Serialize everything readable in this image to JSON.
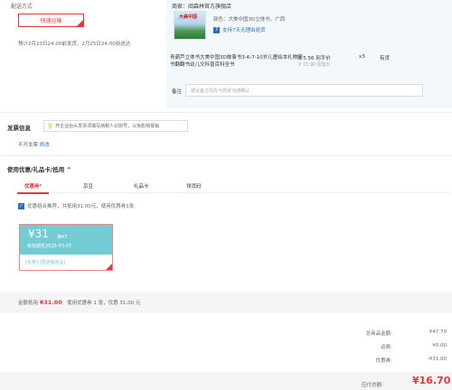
{
  "shipping": {
    "title": "配送方式",
    "option": "快速运输",
    "note": "预计2月23日24:00前发货，2月25日24:00前送达"
  },
  "shop": {
    "label": "商家：",
    "name": "阅森林官方旗舰店"
  },
  "product": {
    "image_text": "大美中国",
    "color": "颜色：大美中国3D立体书，广西",
    "return_policy": "支持7天无理由退货",
    "title": "青葫芦立体书大美中国3D故事书3-6-7-10岁儿童绘本礼物图书翻翻书幼儿文科普百科全书",
    "price": "¥ 5.56 到手价",
    "original_price": "¥ 15.90 原售价",
    "quantity": "x3",
    "stock": "有货"
  },
  "remark": {
    "label": "备注",
    "placeholder": "建议备注前先与商家沟通确认"
  },
  "invoice": {
    "title": "发票信息",
    "notice": "开企业抬头发票须填写纳税人识别号，以免影响报销",
    "status": "不开发票",
    "edit": "修改"
  },
  "coupons": {
    "title": "使用优惠/礼品卡/抵用 ^",
    "tabs": [
      {
        "label": "优惠券⁸"
      },
      {
        "label": "京豆"
      },
      {
        "label": "礼品卡"
      },
      {
        "label": "领货码"
      }
    ],
    "recommend": "优惠组合推荐，共抵用31.00元，使用优惠券1张",
    "coupon": {
      "amount": "¥31",
      "condition": "满47",
      "valid": "有效期至2025-03-07",
      "scope": "[东券] [限店铺商品]"
    },
    "summary_label": "金额抵用",
    "summary_amount": "¥31.00",
    "summary_detail": "使用优惠券 1 张，优惠 31.00 元"
  },
  "totals": [
    {
      "label": "总商品金额:",
      "value": "¥47.70"
    },
    {
      "label": "运费:",
      "value": "¥0.00"
    },
    {
      "label": "优惠券:",
      "value": "-¥31.00"
    }
  ],
  "payable": {
    "label": "应付总额:",
    "amount": "¥16.70"
  },
  "colors": {
    "accent": "#e4393c",
    "link": "#2f6fb9",
    "coupon": "#73ccd3"
  }
}
